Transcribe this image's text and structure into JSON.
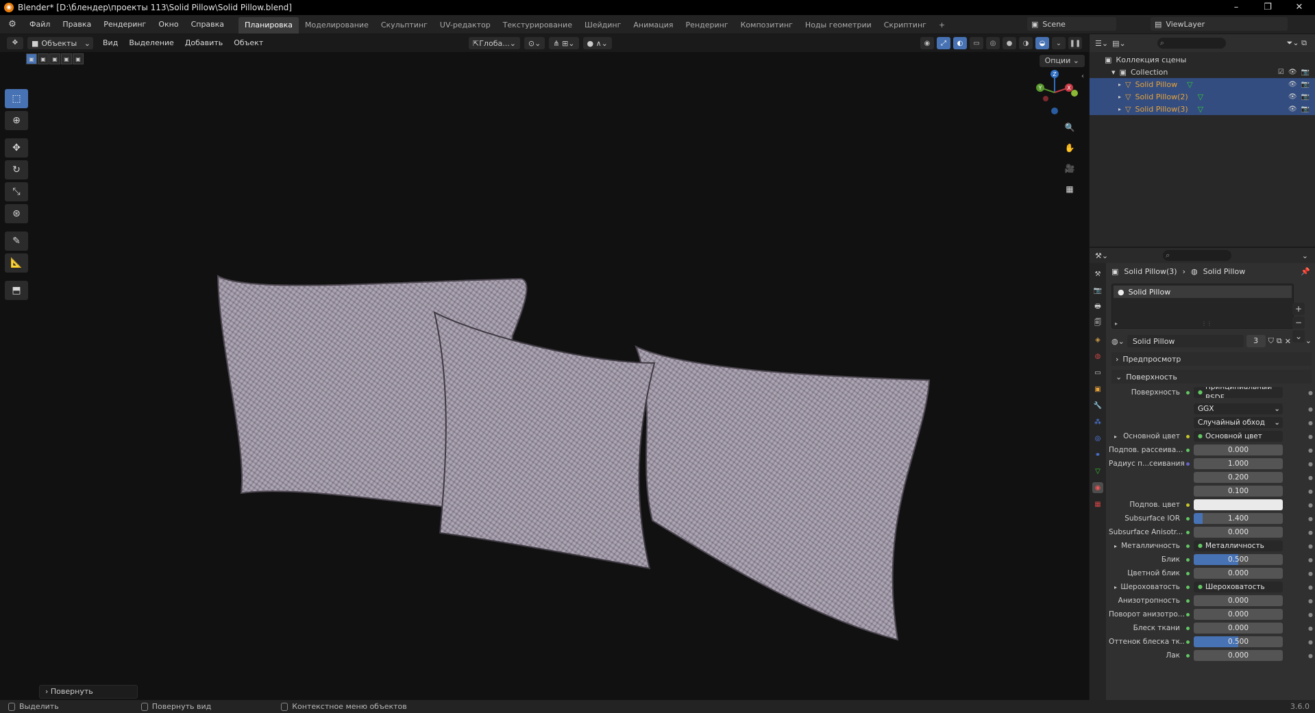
{
  "window": {
    "title": "Blender* [D:\\блендер\\проекты 113\\Solid Pillow\\Solid Pillow.blend]",
    "min": "–",
    "max": "❐",
    "close": "✕"
  },
  "menu": [
    "Файл",
    "Правка",
    "Рендеринг",
    "Окно",
    "Справка"
  ],
  "workspaces": [
    "Планировка",
    "Моделирование",
    "Скульптинг",
    "UV-редактор",
    "Текстурирование",
    "Шейдинг",
    "Анимация",
    "Рендеринг",
    "Композитинг",
    "Ноды геометрии",
    "Скриптинг",
    "+"
  ],
  "scene": "Scene",
  "view_layer": "ViewLayer",
  "viewport": {
    "mode": "Объекты",
    "menus": [
      "Вид",
      "Выделение",
      "Добавить",
      "Объект"
    ],
    "orientation": "Глоба...",
    "options": "Опции",
    "last_operator": "Повернуть",
    "gizmo": {
      "z": "Z",
      "y": "Y",
      "x": "X"
    }
  },
  "outliner": {
    "root": "Коллекция сцены",
    "collection": "Collection",
    "objects": [
      "Solid Pillow",
      "Solid Pillow(2)",
      "Solid Pillow(3)"
    ]
  },
  "properties": {
    "breadcrumb_object": "Solid Pillow(3)",
    "breadcrumb_material": "Solid Pillow",
    "slot": "Solid Pillow",
    "material_name": "Solid Pillow",
    "users": "3",
    "section_preview": "Предпросмотр",
    "section_surface": "Поверхность",
    "rows": [
      {
        "label": "Поверхность",
        "value": "Принципиальный BSDF",
        "kind": "link",
        "dot": "g"
      },
      {
        "label": "",
        "value": "GGX",
        "kind": "dd"
      },
      {
        "label": "",
        "value": "Случайный обход",
        "kind": "dd"
      },
      {
        "label": "Основной цвет",
        "value": "Основной цвет",
        "kind": "link",
        "dot": "y",
        "arrow": true
      },
      {
        "label": "Подпов. рассеива...",
        "value": "0.000",
        "kind": "num",
        "dot": "g",
        "fill": 0
      },
      {
        "label": "Радиус п...сеивания",
        "value": "1.000",
        "kind": "num",
        "dot": "b",
        "fill": 0
      },
      {
        "label": "",
        "value": "0.200",
        "kind": "num",
        "fill": 0
      },
      {
        "label": "",
        "value": "0.100",
        "kind": "num",
        "fill": 0
      },
      {
        "label": "Подпов. цвет",
        "value": "",
        "kind": "white",
        "dot": "y"
      },
      {
        "label": "Subsurface IOR",
        "value": "1.400",
        "kind": "num",
        "dot": "g",
        "fill": 0.1
      },
      {
        "label": "Subsurface Anisotr...",
        "value": "0.000",
        "kind": "num",
        "dot": "g",
        "fill": 0
      },
      {
        "label": "Металличность",
        "value": "Металличность",
        "kind": "link",
        "dot": "g",
        "arrow": true
      },
      {
        "label": "Блик",
        "value": "0.500",
        "kind": "num",
        "dot": "g",
        "fill": 0.5
      },
      {
        "label": "Цветной блик",
        "value": "0.000",
        "kind": "num",
        "dot": "g",
        "fill": 0
      },
      {
        "label": "Шероховатость",
        "value": "Шероховатость",
        "kind": "link",
        "dot": "g",
        "arrow": true
      },
      {
        "label": "Анизотропность",
        "value": "0.000",
        "kind": "num",
        "dot": "g",
        "fill": 0
      },
      {
        "label": "Поворот анизотро...",
        "value": "0.000",
        "kind": "num",
        "dot": "g",
        "fill": 0
      },
      {
        "label": "Блеск ткани",
        "value": "0.000",
        "kind": "num",
        "dot": "g",
        "fill": 0
      },
      {
        "label": "Оттенок блеска тк...",
        "value": "0.500",
        "kind": "num",
        "dot": "g",
        "fill": 0.5
      },
      {
        "label": "Лак",
        "value": "0.000",
        "kind": "num",
        "dot": "g",
        "fill": 0
      }
    ]
  },
  "status": {
    "select": "Выделить",
    "rotate_view": "Повернуть вид",
    "context_menu": "Контекстное меню объектов",
    "version": "3.6.0"
  }
}
